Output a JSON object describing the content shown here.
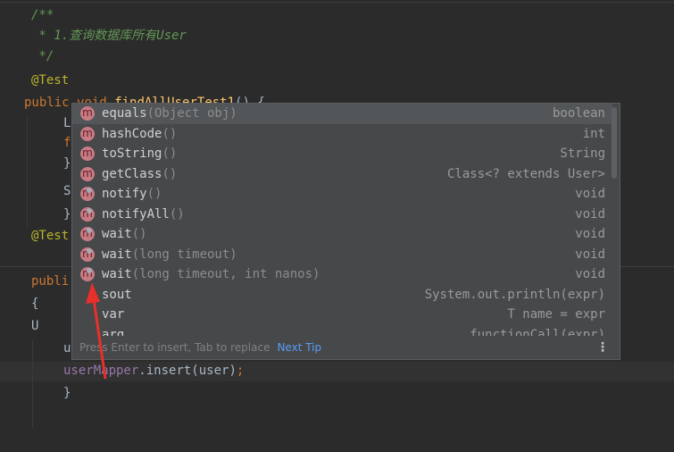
{
  "editor": {
    "lines": [
      {
        "text": "/**",
        "cls": "cm"
      },
      {
        "text": " * 1.查询数据库所有User",
        "cls": "cm"
      },
      {
        "text": " */",
        "cls": "cm"
      },
      {
        "text": "@Test",
        "cls": "ann"
      },
      {
        "kw": "public ",
        "rest": "void ",
        "fn": "findAllUserTest1",
        "tail": "() {"
      },
      {
        "text": "L"
      },
      {
        "text": "f",
        "cls": "kw"
      },
      {
        "text": "}"
      },
      {
        "text": "S"
      },
      {
        "text": "}"
      },
      {
        "text": "@Test",
        "cls": "ann"
      },
      {
        "text": "publi",
        "cls": "kw"
      },
      {
        "text": "{"
      },
      {
        "text": "U"
      },
      {
        "text": "user."
      },
      {
        "field": "userMapper",
        "call": ".insert(user)",
        "semi": ";"
      },
      {
        "text": "}"
      }
    ]
  },
  "completion": {
    "items": [
      {
        "name": "equals",
        "params": "(Object obj)",
        "type": "boolean",
        "icon": "method-icon",
        "inherited": false
      },
      {
        "name": "hashCode",
        "params": "()",
        "type": "int",
        "icon": "method-icon",
        "inherited": false
      },
      {
        "name": "toString",
        "params": "()",
        "type": "String",
        "icon": "method-icon",
        "inherited": false
      },
      {
        "name": "getClass",
        "params": "()",
        "type": "Class<? extends User>",
        "icon": "method-icon",
        "inherited": false
      },
      {
        "name": "notify",
        "params": "()",
        "type": "void",
        "icon": "method-icon",
        "inherited": true
      },
      {
        "name": "notifyAll",
        "params": "()",
        "type": "void",
        "icon": "method-icon",
        "inherited": true
      },
      {
        "name": "wait",
        "params": "()",
        "type": "void",
        "icon": "method-icon",
        "inherited": true
      },
      {
        "name": "wait",
        "params": "(long timeout)",
        "type": "void",
        "icon": "method-icon",
        "inherited": true
      },
      {
        "name": "wait",
        "params": "(long timeout, int nanos)",
        "type": "void",
        "icon": "method-icon",
        "inherited": true
      },
      {
        "name": "sout",
        "params": "",
        "type": "System.out.println(expr)",
        "icon": ""
      },
      {
        "name": "var",
        "params": "",
        "type": "T name = expr",
        "icon": ""
      },
      {
        "name": "arg",
        "params": "",
        "type": "functionCall(expr)",
        "icon": ""
      }
    ],
    "footer": "Press Enter to insert, Tab to replace",
    "next_tip": "Next Tip",
    "icon_letter": "m"
  },
  "colors": {
    "arrow": "#e8302a",
    "link": "#589df6"
  }
}
